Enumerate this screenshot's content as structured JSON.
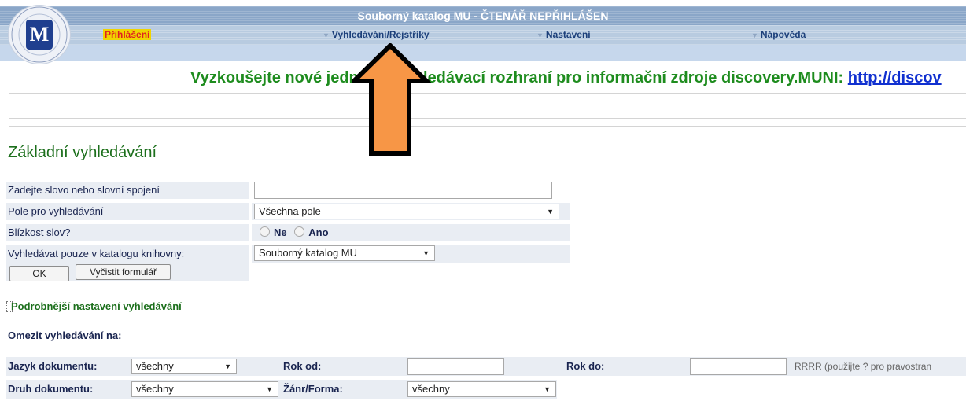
{
  "header": {
    "title": "Souborný katalog MU - ČTENÁŘ NEPŘIHLÁŠEN",
    "menu": {
      "login": "Přihlášení",
      "search": "Vyhledávání/Rejstříky",
      "settings": "Nastavení",
      "help": "Nápověda"
    },
    "logo_text": "UNIVERSITAS MASARYKIANA BRUNENSIS"
  },
  "banner": {
    "text": "Vyzkoušejte nové jednotné vyhledávací rozhraní pro informační zdroje discovery.MUNI: ",
    "link": "http://discov"
  },
  "search": {
    "title": "Základní vyhledávání",
    "query_label": "Zadejte slovo nebo slovní spojení",
    "query_value": "",
    "field_label": "Pole pro vyhledávání",
    "field_selected": "Všechna pole",
    "proximity_label": "Blízkost slov?",
    "proximity_options": [
      "Ne",
      "Ano"
    ],
    "catalog_label": "Vyhledávat pouze v katalogu knihovny:",
    "catalog_selected": "Souborný katalog MU",
    "ok_button": "OK",
    "clear_button": "Vyčistit formulář"
  },
  "advanced": {
    "link": "Podrobnější nastavení vyhledávání",
    "limit_label": "Omezit vyhledávání na:",
    "language_label": "Jazyk dokumentu:",
    "language_selected": "všechny",
    "year_from_label": "Rok od:",
    "year_from_value": "",
    "year_to_label": "Rok do:",
    "year_to_value": "",
    "year_hint": "RRRR (použijte ? pro pravostran",
    "doctype_label": "Druh dokumentu:",
    "doctype_selected": "všechny",
    "genre_label": "Žánr/Forma:",
    "genre_selected": "všechny"
  },
  "colors": {
    "title_bar": "#8aa6c8",
    "menu_bar": "#b8cbe0",
    "banner_green": "#1e8c1e",
    "link_blue": "#1030d0",
    "arrow_fill": "#f79646"
  }
}
